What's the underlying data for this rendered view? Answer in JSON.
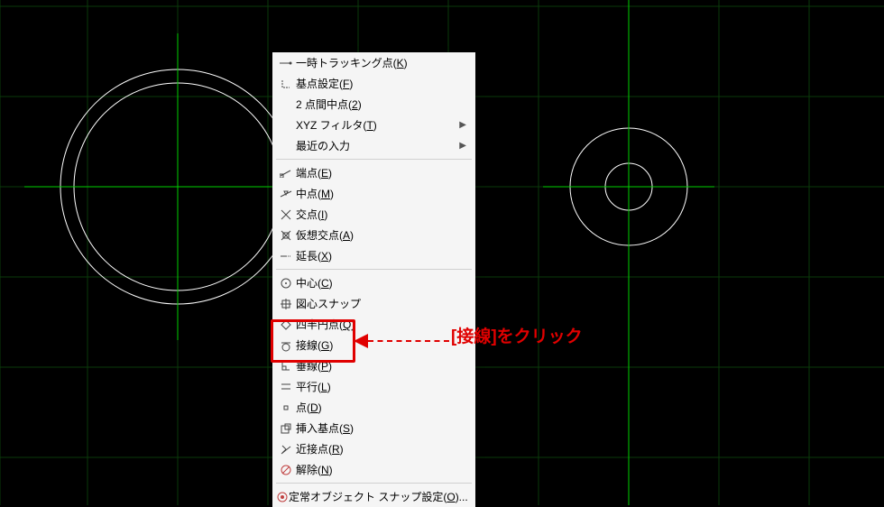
{
  "menu": {
    "tracking_point": "一時トラッキング点(K)",
    "base_point": "基点設定(F)",
    "mid2": "2 点間中点(2)",
    "xyz_filter": "XYZ フィルタ(T)",
    "recent": "最近の入力",
    "endpoint": "端点(E)",
    "midpoint": "中点(M)",
    "intersection": "交点(I)",
    "apparent": "仮想交点(A)",
    "extension": "延長(X)",
    "center": "中心(C)",
    "centroid": "図心スナップ",
    "quadrant": "四半円点(Q)",
    "tangent": "接線(G)",
    "perpendicular": "垂線(P)",
    "parallel": "平行(L)",
    "node": "点(D)",
    "insert": "挿入基点(S)",
    "nearest": "近接点(R)",
    "none": "解除(N)",
    "osnap_settings": "定常オブジェクト スナップ設定(O)..."
  },
  "callout": "[接線]をクリック"
}
